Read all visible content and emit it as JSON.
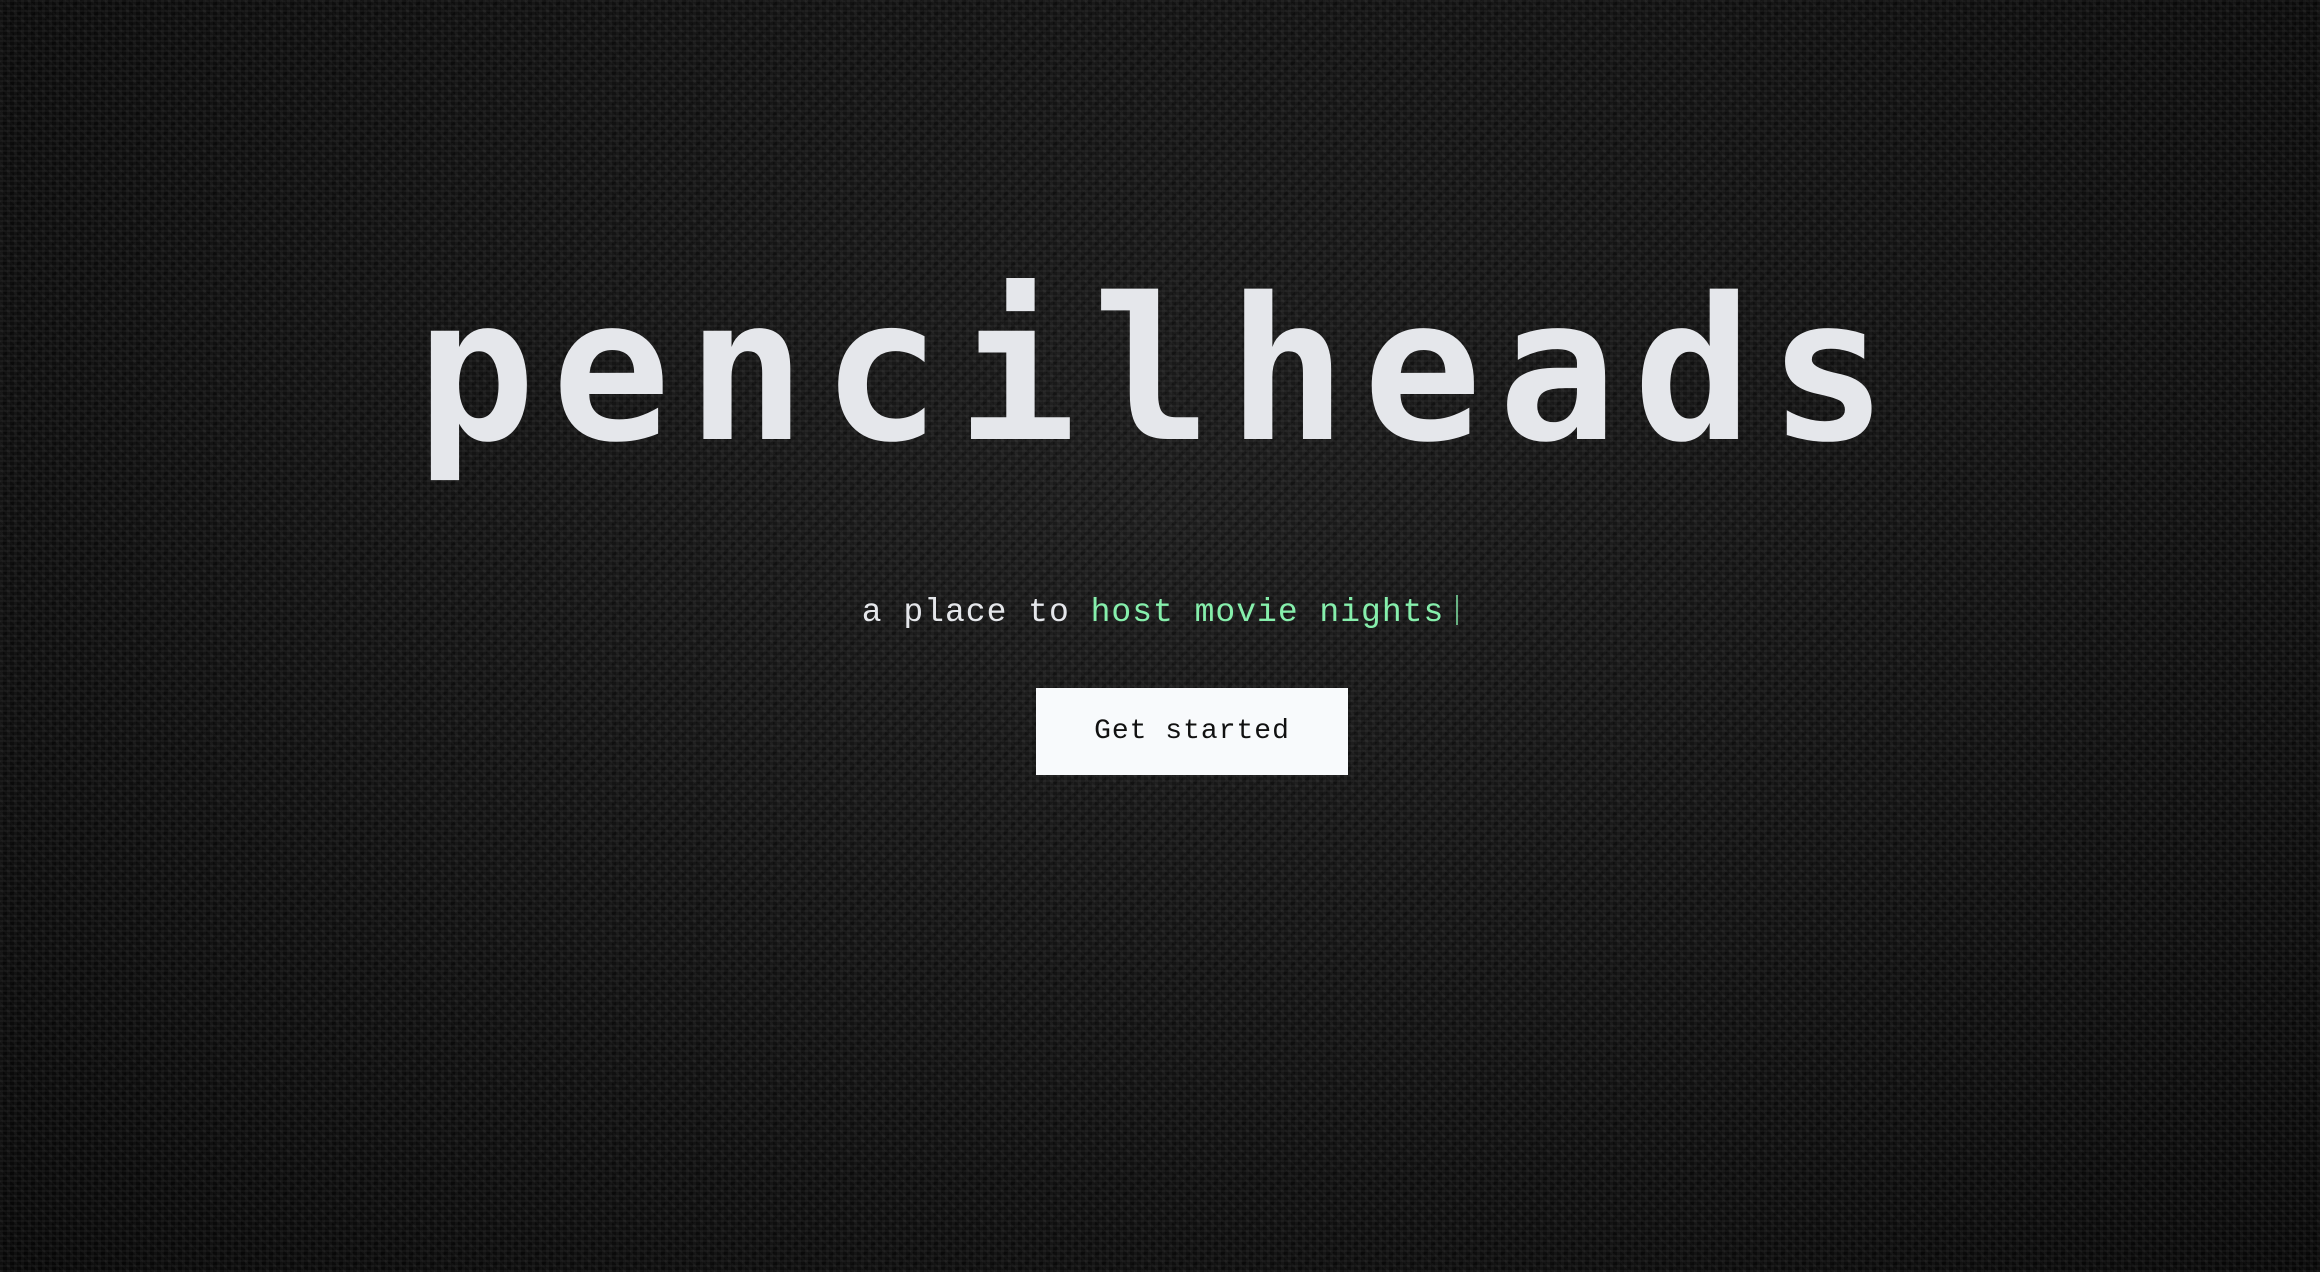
{
  "hero": {
    "logo": "pencilheads",
    "tagline_prefix": "a place to ",
    "tagline_typed": "host movie nights",
    "cta_label": "Get started"
  },
  "colors": {
    "background": "#0d0d0d",
    "text": "#e5e7eb",
    "accent": "#86efac",
    "button_bg": "#f8fafc",
    "button_text": "#111111"
  }
}
